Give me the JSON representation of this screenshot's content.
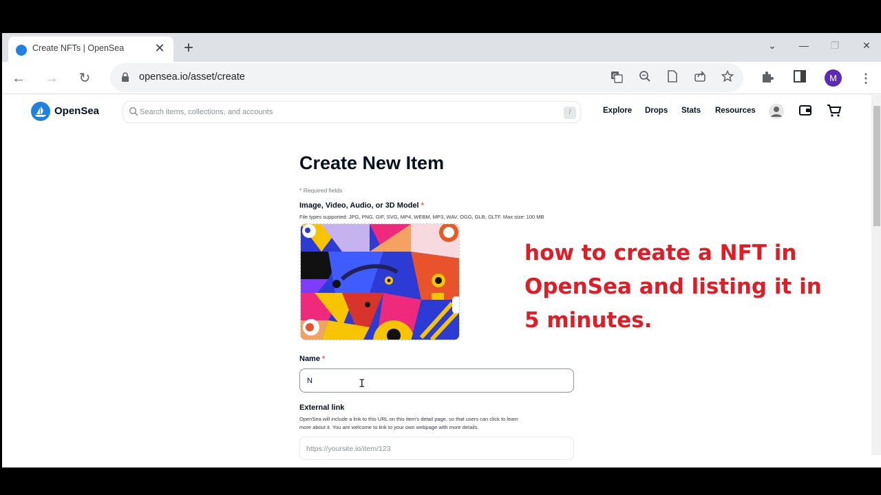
{
  "browser": {
    "tab_title": "Create NFTs | OpenSea",
    "tab_close": "✕",
    "new_tab": "+",
    "url": "opensea.io/asset/create",
    "profile_initial": "M",
    "window_controls": {
      "dropdown": "⌄",
      "minimize": "—",
      "restore": "❐",
      "close": "✕"
    },
    "nav": {
      "back": "←",
      "forward": "→",
      "reload": "↻"
    }
  },
  "header": {
    "logo_text": "OpenSea",
    "search_placeholder": "Search items, collections, and accounts",
    "search_shortcut": "/",
    "nav_links": [
      "Explore",
      "Drops",
      "Stats",
      "Resources"
    ]
  },
  "form": {
    "title": "Create New Item",
    "required_note": "Required fields",
    "media_label": "Image, Video, Audio, or 3D Model",
    "media_help": "File types supported: JPG, PNG, GIF, SVG, MP4, WEBM, MP3, WAV, OGG, GLB, GLTF. Max size: 100 MB",
    "name_label": "Name",
    "name_value": "N",
    "external_label": "External link",
    "external_help_1": "OpenSea will include a link to this URL on this item's detail page, so that users can click to learn",
    "external_help_2": "more about it. You are welcome to link to your own webpage with more details.",
    "external_placeholder": "https://yoursite.io/item/123"
  },
  "overlay": {
    "line1": "how to create a NFT in",
    "line2": "OpenSea and listing it in",
    "line3": "5 minutes."
  },
  "colors": {
    "accent": "#2081e2",
    "overlay_text": "#e21b24",
    "profile": "#5b2bb5"
  }
}
